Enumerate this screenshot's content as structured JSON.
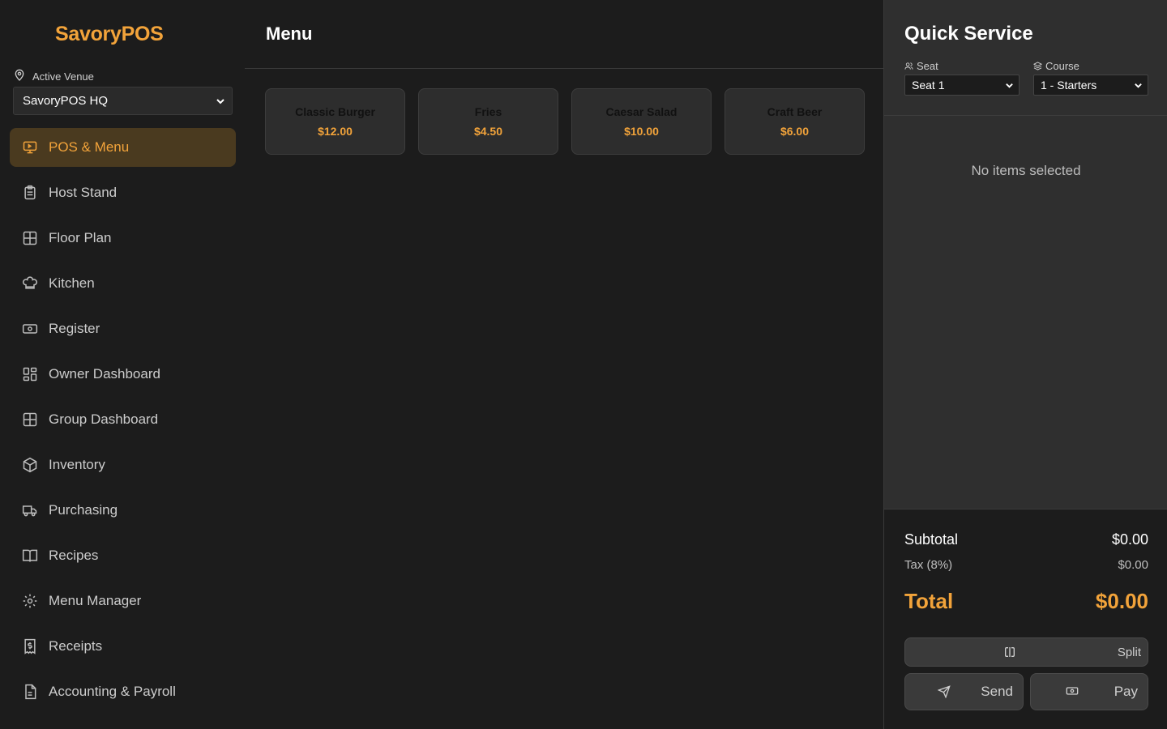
{
  "sidebar": {
    "brand": "SavoryPOS",
    "venue_label": "Active Venue",
    "venue_selected": "SavoryPOS HQ",
    "items": [
      {
        "label": "POS & Menu",
        "icon": "pos-monitor-icon",
        "active": true
      },
      {
        "label": "Host Stand",
        "icon": "clipboard-icon"
      },
      {
        "label": "Floor Plan",
        "icon": "grid-icon"
      },
      {
        "label": "Kitchen",
        "icon": "chef-hat-icon"
      },
      {
        "label": "Register",
        "icon": "cash-icon"
      },
      {
        "label": "Owner Dashboard",
        "icon": "dashboard-icon"
      },
      {
        "label": "Group Dashboard",
        "icon": "grid-icon"
      },
      {
        "label": "Inventory",
        "icon": "box-icon"
      },
      {
        "label": "Purchasing",
        "icon": "truck-icon"
      },
      {
        "label": "Recipes",
        "icon": "book-icon"
      },
      {
        "label": "Menu Manager",
        "icon": "gear-icon"
      },
      {
        "label": "Receipts",
        "icon": "receipt-icon"
      },
      {
        "label": "Accounting & Payroll",
        "icon": "document-icon"
      }
    ]
  },
  "main": {
    "title": "Menu",
    "items": [
      {
        "name": "Classic Burger",
        "price": "$12.00"
      },
      {
        "name": "Fries",
        "price": "$4.50"
      },
      {
        "name": "Caesar Salad",
        "price": "$10.00"
      },
      {
        "name": "Craft Beer",
        "price": "$6.00"
      }
    ]
  },
  "panel": {
    "title": "Quick Service",
    "seat_label": "Seat",
    "seat_selected": "Seat 1",
    "course_label": "Course",
    "course_selected": "1 - Starters",
    "empty": "No items selected",
    "subtotal_label": "Subtotal",
    "subtotal": "$0.00",
    "tax_label": "Tax (8%)",
    "tax": "$0.00",
    "total_label": "Total",
    "total": "$0.00",
    "split_label": "Split",
    "send_label": "Send",
    "pay_label": "Pay"
  },
  "colors": {
    "accent": "#f2a33a",
    "background": "#1c1c1c",
    "panel": "#2f2f2f"
  }
}
